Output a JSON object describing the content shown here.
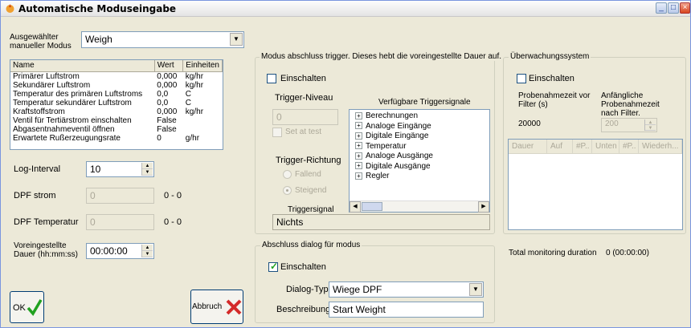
{
  "window": {
    "title": "Automatische Moduseingabe"
  },
  "left": {
    "mode_label": "Ausgewählter manueller Modus",
    "mode_value": "Weigh",
    "table": {
      "headers": [
        "Name",
        "Wert",
        "Einheiten"
      ],
      "rows": [
        [
          "Primärer Luftstrom",
          "0,000",
          "kg/hr"
        ],
        [
          "Sekundärer Luftstrom",
          "0,000",
          "kg/hr"
        ],
        [
          "Temperatur des primären Luftstroms",
          "0,0",
          "C"
        ],
        [
          "Temperatur sekundärer Luftstrom",
          "0,0",
          "C"
        ],
        [
          "Kraftstoffstrom",
          "0,000",
          "kg/hr"
        ],
        [
          "Ventil für Tertiärstrom einschalten",
          "False",
          ""
        ],
        [
          "Abgasentnahmeventil öffnen",
          "False",
          ""
        ],
        [
          "Erwartete Rußerzeugungsrate",
          "0",
          "g/hr"
        ]
      ]
    },
    "log_interval_label": "Log-Interval",
    "log_interval_value": "10",
    "dpf_strom_label": "DPF strom",
    "dpf_strom_value": "0",
    "dpf_strom_range": "0 - 0",
    "dpf_temp_label": "DPF Temperatur",
    "dpf_temp_value": "0",
    "dpf_temp_range": "0 - 0",
    "duration_label": "Voreingestellte Dauer (hh:mm:ss)",
    "duration_value": "00:00:00",
    "ok_label": "OK",
    "abbruch_label": "Abbruch"
  },
  "trigger": {
    "group_title": "Modus abschluss trigger. Dieses hebt die voreingestellte Dauer auf.",
    "enable_label": "Einschalten",
    "level_label": "Trigger-Niveau",
    "level_value": "0",
    "set_at_test_label": "Set at test",
    "direction_label": "Trigger-Richtung",
    "falling_label": "Fallend",
    "rising_label": "Steigend",
    "signals_label": "Verfügbare Triggersignale",
    "signals": [
      "Berechnungen",
      "Analoge Eingänge",
      "Digitale Eingänge",
      "Temperatur",
      "Analoge Ausgänge",
      "Digitale Ausgänge",
      "Regler"
    ],
    "triggersignal_label": "Triggersignal",
    "triggersignal_value": "Nichts"
  },
  "dialog": {
    "group_title": "Abschluss dialog für modus",
    "enable_label": "Einschalten",
    "type_label": "Dialog-Typ",
    "type_value": "Wiege DPF",
    "desc_label": "Beschreibung",
    "desc_value": "Start Weight"
  },
  "monitor": {
    "group_title": "Überwachungssystem",
    "enable_label": "Einschalten",
    "sample_time_label": "Probenahmezeit vor Filter (s)",
    "sample_time_value": "20000",
    "initial_sample_label": "Anfängliche Probenahmezeit nach Filter.",
    "initial_sample_value": "200",
    "columns": [
      "Dauer",
      "Auf",
      "#P..",
      "Unten",
      "#P..",
      "Wiederh..."
    ],
    "total_label": "Total monitoring duration",
    "total_value": "0 (00:00:00)"
  },
  "colors": {
    "accent": "#316ac5",
    "check_green": "#21a121",
    "cancel_red": "#d42a2a"
  }
}
